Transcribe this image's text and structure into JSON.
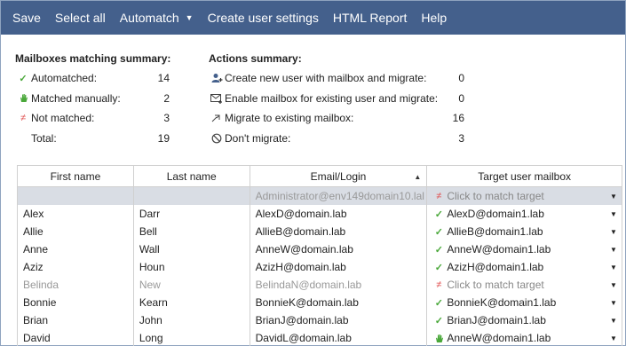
{
  "toolbar": {
    "save": "Save",
    "select_all": "Select all",
    "automatch": "Automatch",
    "create_user_settings": "Create user settings",
    "html_report": "HTML Report",
    "help": "Help"
  },
  "matching_summary": {
    "title": "Mailboxes matching summary:",
    "rows": [
      {
        "icon": "check-icon",
        "label": "Automatched:",
        "value": "14"
      },
      {
        "icon": "hand-icon",
        "label": "Matched manually:",
        "value": "2"
      },
      {
        "icon": "not-equal-icon",
        "label": "Not matched:",
        "value": "3"
      },
      {
        "icon": "",
        "label": "Total:",
        "value": "19"
      }
    ]
  },
  "actions_summary": {
    "title": "Actions summary:",
    "rows": [
      {
        "icon": "add-user-icon",
        "label": "Create new user with mailbox and migrate:",
        "value": "0"
      },
      {
        "icon": "mail-enable-icon",
        "label": "Enable mailbox for existing user and migrate:",
        "value": "0"
      },
      {
        "icon": "migrate-arrow-icon",
        "label": "Migrate to existing mailbox:",
        "value": "16"
      },
      {
        "icon": "block-icon",
        "label": "Don't migrate:",
        "value": "3"
      }
    ]
  },
  "grid": {
    "columns": [
      "First name",
      "Last name",
      "Email/Login",
      "Target user mailbox"
    ],
    "sort_column": "Email/Login",
    "rows": [
      {
        "first": "",
        "last": "",
        "email": "Administrator@env149domain10.lal",
        "target": "Click to match target",
        "status": "not-matched",
        "selected": true
      },
      {
        "first": "Alex",
        "last": "Darr",
        "email": "AlexD@domain.lab",
        "target": "AlexD@domain1.lab",
        "status": "auto"
      },
      {
        "first": "Allie",
        "last": "Bell",
        "email": "AllieB@domain.lab",
        "target": "AllieB@domain1.lab",
        "status": "auto"
      },
      {
        "first": "Anne",
        "last": "Wall",
        "email": "AnneW@domain.lab",
        "target": "AnneW@domain1.lab",
        "status": "auto"
      },
      {
        "first": "Aziz",
        "last": "Houn",
        "email": "AzizH@domain.lab",
        "target": "AzizH@domain1.lab",
        "status": "auto"
      },
      {
        "first": "Belinda",
        "last": "New",
        "email": "BelindaN@domain.lab",
        "target": "Click to match target",
        "status": "not-matched"
      },
      {
        "first": "Bonnie",
        "last": "Kearn",
        "email": "BonnieK@domain.lab",
        "target": "BonnieK@domain1.lab",
        "status": "auto"
      },
      {
        "first": "Brian",
        "last": "John",
        "email": "BrianJ@domain.lab",
        "target": "BrianJ@domain1.lab",
        "status": "auto"
      },
      {
        "first": "David",
        "last": "Long",
        "email": "DavidL@domain.lab",
        "target": "AnneW@domain1.lab",
        "status": "manual"
      }
    ]
  },
  "colors": {
    "toolbar_bg": "#44608c",
    "matched_green": "#4aa83a",
    "not_matched_red": "#e05050",
    "selected_row": "#d9dde4"
  }
}
